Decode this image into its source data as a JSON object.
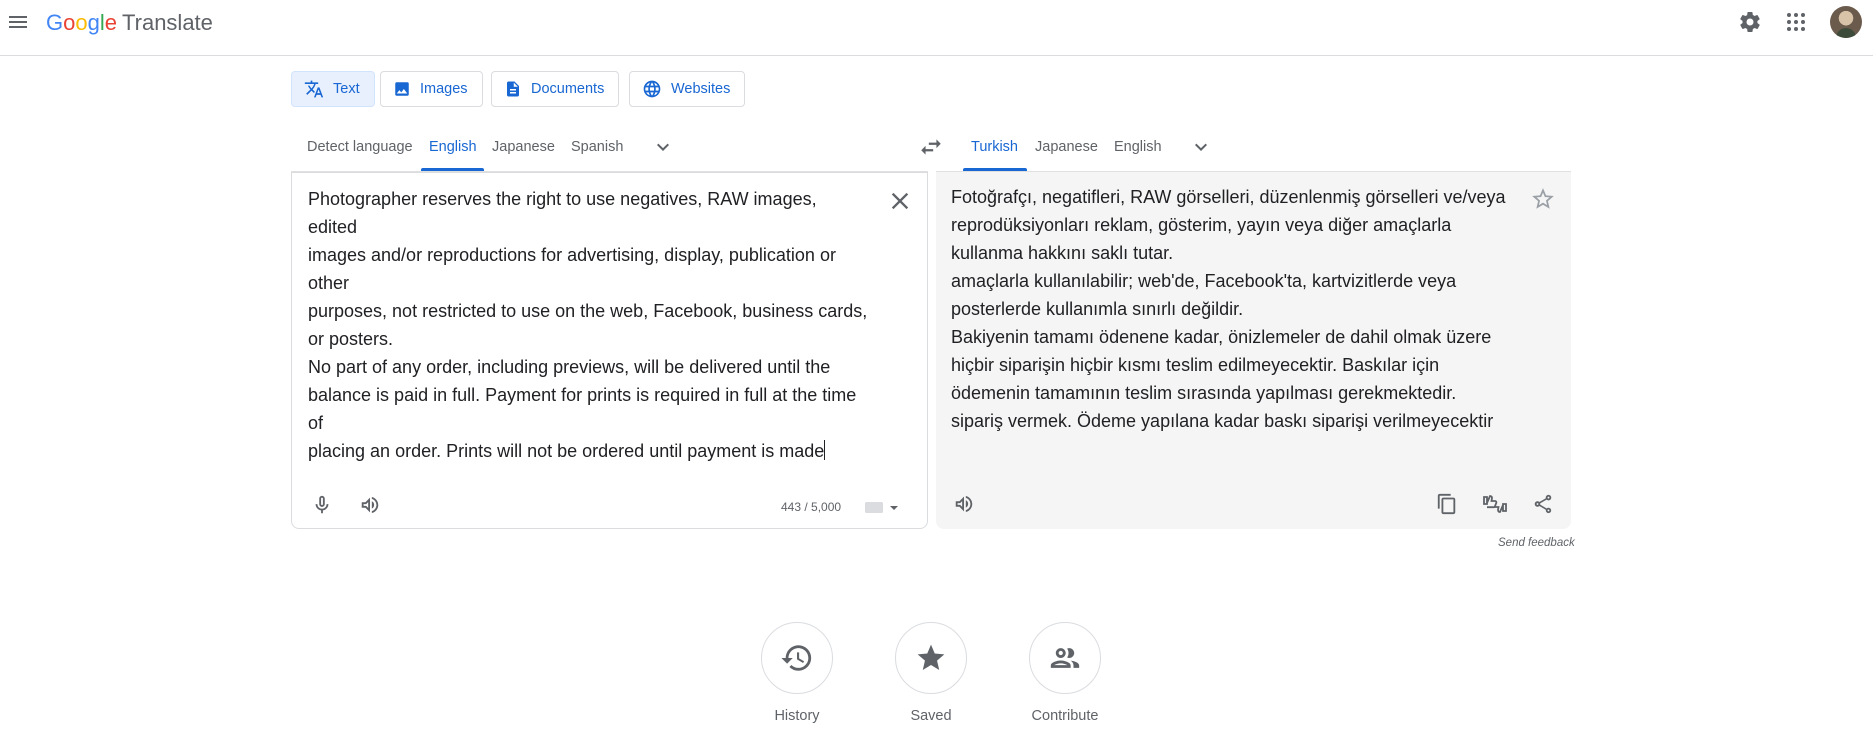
{
  "header": {
    "logo_letters": [
      "G",
      "o",
      "o",
      "g",
      "l",
      "e"
    ],
    "logo_colors": [
      "#4285f4",
      "#ea4335",
      "#fbbc05",
      "#4285f4",
      "#34a853",
      "#ea4335"
    ],
    "product": "Translate",
    "icons": [
      "menu-icon",
      "gear-icon",
      "apps-grid-icon",
      "avatar"
    ]
  },
  "mode_tabs": [
    {
      "label": "Text",
      "icon": "translate-icon",
      "active": true
    },
    {
      "label": "Images",
      "icon": "image-icon",
      "active": false
    },
    {
      "label": "Documents",
      "icon": "document-icon",
      "active": false
    },
    {
      "label": "Websites",
      "icon": "globe-icon",
      "active": false
    }
  ],
  "source_langs": [
    "Detect language",
    "English",
    "Japanese",
    "Spanish"
  ],
  "source_selected": "English",
  "target_langs": [
    "Turkish",
    "Japanese",
    "English"
  ],
  "target_selected": "Turkish",
  "source": {
    "lines": [
      "Photographer reserves the right to use negatives, RAW images, edited",
      "images and/or reproductions for advertising, display, publication or",
      "other",
      "purposes, not restricted to use on the web, Facebook, business cards,",
      "or posters.",
      "No part of any order, including previews, will be delivered until the",
      "balance is paid in full. Payment for prints is required in full at the time",
      "of",
      "placing an order. Prints will not be ordered until payment is made"
    ],
    "char_count": "443 / 5,000"
  },
  "target": {
    "lines": [
      "Fotoğrafçı, negatifleri, RAW görselleri, düzenlenmiş görselleri ve/veya",
      "reprodüksiyonları reklam, gösterim, yayın veya diğer amaçlarla",
      "kullanma hakkını saklı tutar.",
      "amaçlarla kullanılabilir; web'de, Facebook'ta, kartvizitlerde veya",
      "posterlerde kullanımla sınırlı değildir.",
      "Bakiyenin tamamı ödenene kadar, önizlemeler de dahil olmak üzere",
      "hiçbir siparişin hiçbir kısmı teslim edilmeyecektir. Baskılar için",
      "ödemenin tamamının teslim sırasında yapılması gerekmektedir.",
      "sipariş vermek. Ödeme yapılana kadar baskı siparişi verilmeyecektir"
    ]
  },
  "send_feedback": "Send feedback",
  "bottom": [
    {
      "label": "History",
      "icon": "history-icon"
    },
    {
      "label": "Saved",
      "icon": "star-icon"
    },
    {
      "label": "Contribute",
      "icon": "people-icon"
    }
  ],
  "colors": {
    "accent": "#1967d2",
    "text": "#202124",
    "muted": "#5f6368",
    "panel": "#f5f5f5",
    "border": "#dadce0"
  }
}
